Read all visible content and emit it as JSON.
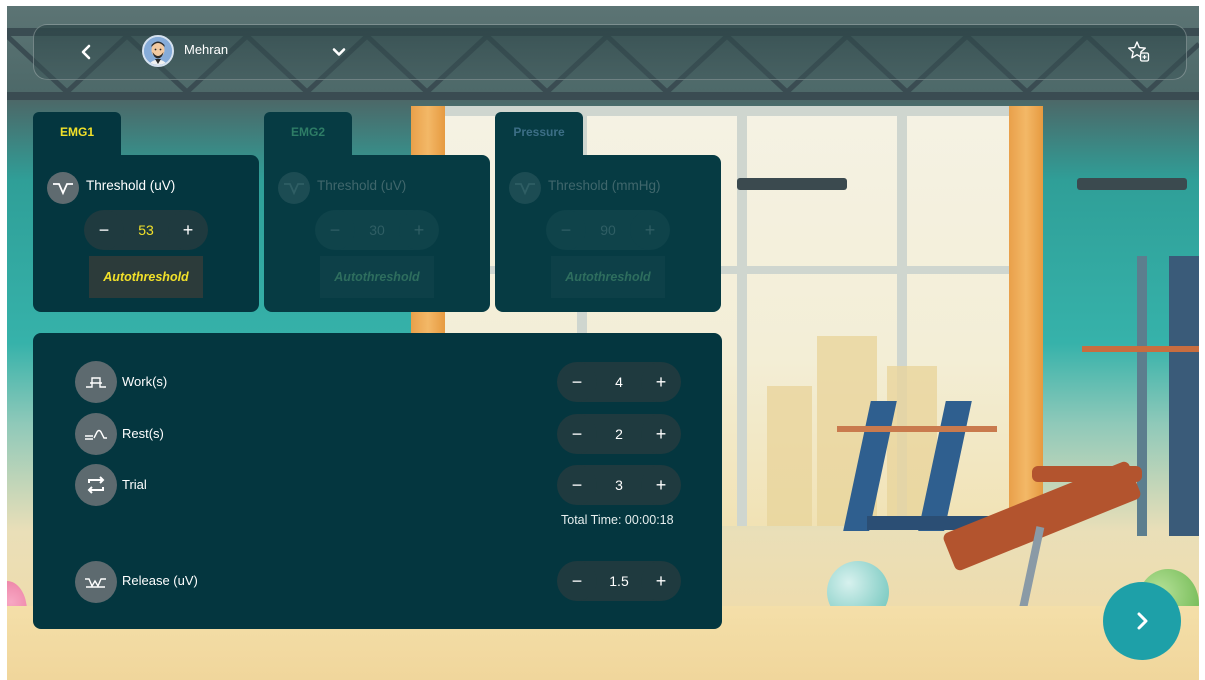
{
  "header": {
    "user_name": "Mehran",
    "back_icon": "chevron-left-icon",
    "dropdown_icon": "chevron-down-icon",
    "favorite_icon": "star-add-icon"
  },
  "sensors": [
    {
      "tab_label": "EMG1",
      "tab_color": "#f2e12a",
      "active": true,
      "threshold_label": "Threshold (uV)",
      "threshold_value": "53",
      "minus": "−",
      "plus": "+",
      "auto_label": "Autothreshold"
    },
    {
      "tab_label": "EMG2",
      "tab_color": "#2e7d66",
      "active": false,
      "threshold_label": "Threshold (uV)",
      "threshold_value": "30",
      "minus": "−",
      "plus": "+",
      "auto_label": "Autothreshold"
    },
    {
      "tab_label": "Pressure",
      "tab_color": "#3c6e86",
      "active": false,
      "threshold_label": "Threshold (mmHg)",
      "threshold_value": "90",
      "minus": "−",
      "plus": "+",
      "auto_label": "Autothreshold"
    }
  ],
  "params": {
    "work": {
      "label": "Work(s)",
      "value": "4",
      "icon": "work-pulse-icon"
    },
    "rest": {
      "label": "Rest(s)",
      "value": "2",
      "icon": "rest-pulse-icon"
    },
    "trial": {
      "label": "Trial",
      "value": "3",
      "icon": "repeat-icon"
    },
    "total_time": "Total Time: 00:00:18",
    "release": {
      "label": "Release (uV)",
      "value": "1.5",
      "icon": "release-wave-icon"
    },
    "minus": "−",
    "plus": "+"
  },
  "next_icon": "chevron-right-icon"
}
